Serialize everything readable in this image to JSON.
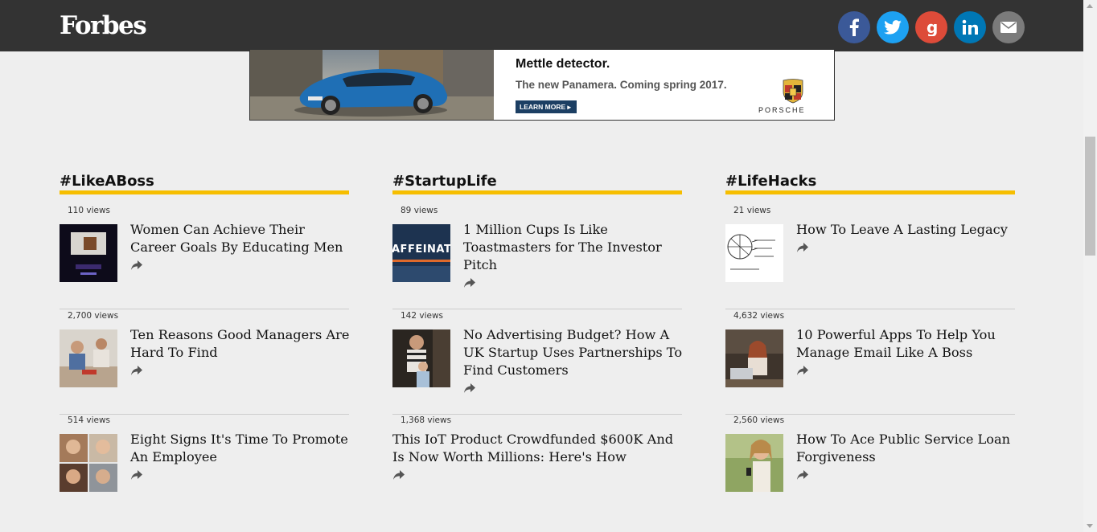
{
  "header": {
    "logo": "Forbes",
    "social": [
      {
        "name": "facebook-icon",
        "glyph": "f",
        "color": "#3b5998"
      },
      {
        "name": "twitter-icon",
        "glyph": "",
        "color": "#1da1f2"
      },
      {
        "name": "google-plus-icon",
        "glyph": "g",
        "color": "#dd4b39"
      },
      {
        "name": "linkedin-icon",
        "glyph": "in",
        "color": "#0077b5"
      },
      {
        "name": "email-icon",
        "glyph": "",
        "color": "#7b7b7b"
      }
    ]
  },
  "ad": {
    "headline": "Mettle detector.",
    "subline": "The new Panamera. Coming spring 2017.",
    "button": "LEARN MORE ▸",
    "brand": "PORSCHE"
  },
  "columns": [
    {
      "heading": "#LikeABoss",
      "items": [
        {
          "views": "110 views",
          "title": "Women Can Achieve Their Career Goals By Educating Men",
          "thumb": "stage-photo"
        },
        {
          "views": "2,700 views",
          "title": "Ten Reasons Good Managers Are Hard To Find",
          "thumb": "meeting-photo"
        },
        {
          "views": "514 views",
          "title": "Eight Signs It's Time To Promote An Employee",
          "thumb": "portraits-photo"
        }
      ]
    },
    {
      "heading": "#StartupLife",
      "items": [
        {
          "views": "89 views",
          "title": "1 Million Cups Is Like Toastmasters for The Investor Pitch",
          "thumb": "presentation-photo",
          "thumb_text": "AFFEINATIN"
        },
        {
          "views": "142 views",
          "title": "No Advertising Budget? How A UK Startup Uses Partnerships To Find Customers",
          "thumb": "mother-child-photo"
        },
        {
          "views": "1,368 views",
          "title": "This IoT Product Crowdfunded $600K And Is Now Worth Millions: Here's How",
          "thumb": ""
        }
      ]
    },
    {
      "heading": "#LifeHacks",
      "items": [
        {
          "views": "21 views",
          "title": "How To Leave A Lasting Legacy",
          "thumb": "sketch-photo"
        },
        {
          "views": "4,632 views",
          "title": "10 Powerful Apps To Help You Manage Email Like A Boss",
          "thumb": "laptop-woman-photo"
        },
        {
          "views": "2,560 views",
          "title": "How To Ace Public Service Loan Forgiveness",
          "thumb": "phone-woman-photo"
        }
      ]
    }
  ]
}
